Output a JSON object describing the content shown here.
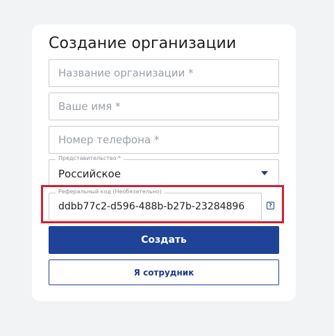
{
  "form": {
    "title": "Создание организации",
    "org_name": {
      "placeholder": "Название организации *",
      "value": ""
    },
    "user_name": {
      "placeholder": "Ваше имя *",
      "value": ""
    },
    "phone": {
      "placeholder": "Номер телефона *",
      "value": ""
    },
    "representation": {
      "label": "Представительство *",
      "selected": "Российское"
    },
    "referral": {
      "label": "Реферальный код (Необязательно)",
      "value": "ddbb77c2-d596-488b-b27b-23284896"
    },
    "help_icon": "question-mark-icon",
    "create_button": "Создать",
    "employee_button": "Я сотрудник"
  },
  "colors": {
    "primary": "#1e4397",
    "highlight": "#d32030",
    "background": "#f2f3f5"
  }
}
